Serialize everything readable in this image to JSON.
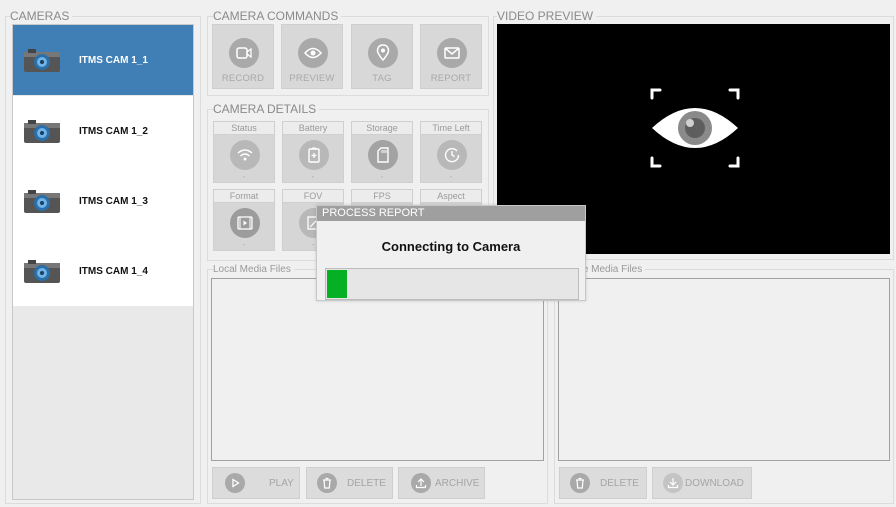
{
  "cameras": {
    "title": "CAMERAS",
    "items": [
      {
        "label": "ITMS CAM 1_1",
        "selected": true
      },
      {
        "label": "ITMS CAM 1_2",
        "selected": false
      },
      {
        "label": "ITMS CAM 1_3",
        "selected": false
      },
      {
        "label": "ITMS CAM 1_4",
        "selected": false
      }
    ]
  },
  "commands": {
    "title": "CAMERA COMMANDS",
    "record": "RECORD",
    "preview": "PREVIEW",
    "tag": "TAG",
    "report": "REPORT"
  },
  "details": {
    "title": "CAMERA DETAILS",
    "status": {
      "label": "Status",
      "value": "-"
    },
    "battery": {
      "label": "Battery",
      "value": "-"
    },
    "storage": {
      "label": "Storage",
      "value": "-"
    },
    "time_left": {
      "label": "Time Left",
      "value": "-"
    },
    "format": {
      "label": "Format",
      "value": "-"
    },
    "fov": {
      "label": "FOV",
      "value": "-"
    },
    "fps": {
      "label": "FPS"
    },
    "aspect": {
      "label": "Aspect"
    }
  },
  "video_preview": {
    "title": "VIDEO PREVIEW"
  },
  "local_media": {
    "title": "Local Media Files",
    "play": "PLAY",
    "delete": "DELETE",
    "archive": "ARCHIVE"
  },
  "remote_media": {
    "title": "te Media Files",
    "delete": "DELETE",
    "download": "DOWNLOAD"
  },
  "dialog": {
    "title": "PROCESS REPORT",
    "message": "Connecting to Camera",
    "progress": 0.08
  },
  "colors": {
    "selected": "#3f7fb5",
    "progress": "#06b025",
    "preview_bg": "#000000"
  }
}
